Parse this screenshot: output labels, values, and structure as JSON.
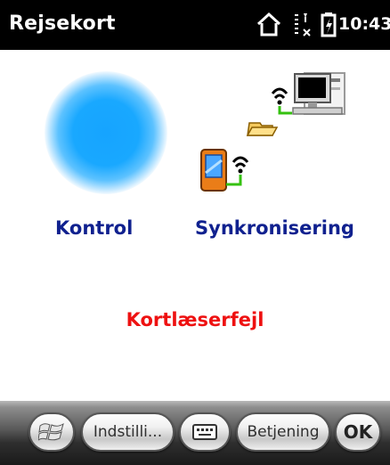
{
  "status_bar": {
    "title": "Rejsekort",
    "time": "10:43",
    "icons": [
      "home-icon",
      "signal-icon",
      "battery-icon"
    ]
  },
  "main": {
    "indicator_icon": "blue-status-dot",
    "sync_icon": "pda-sync-computer-icon",
    "control_label": "Kontrol",
    "sync_label": "Synkronisering",
    "error_text": "Kortlæserfejl"
  },
  "taskbar": {
    "start_icon": "windows-start-icon",
    "settings_label": "Indstilli...",
    "keyboard_icon": "keyboard-icon",
    "operation_label": "Betjening",
    "ok_label": "OK"
  },
  "colors": {
    "status_bar_bg": "#000000",
    "label_blue": "#10218f",
    "error_red": "#ee1111",
    "indicator_blue": "#19a8ff"
  }
}
